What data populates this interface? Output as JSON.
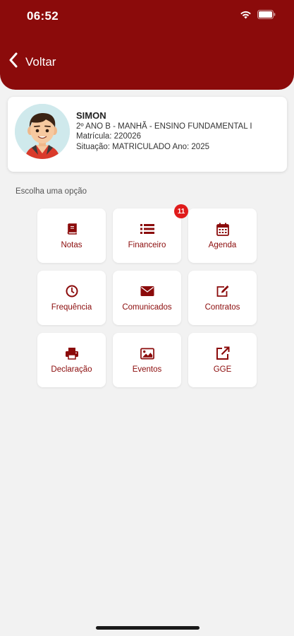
{
  "status_bar": {
    "time": "06:52"
  },
  "header": {
    "back_label": "Voltar"
  },
  "student": {
    "name": "SIMON",
    "class_line": "2º ANO B - MANHÃ - ENSINO FUNDAMENTAL I",
    "matricula_line": "Matrícula: 220026",
    "situacao_line": "Situação: MATRICULADO Ano: 2025"
  },
  "section_label": "Escolha uma opção",
  "menu": [
    {
      "label": "Notas",
      "icon": "book-icon"
    },
    {
      "label": "Financeiro",
      "icon": "list-icon",
      "badge": "11"
    },
    {
      "label": "Agenda",
      "icon": "calendar-icon"
    },
    {
      "label": "Frequência",
      "icon": "clock-icon"
    },
    {
      "label": "Comunicados",
      "icon": "envelope-icon"
    },
    {
      "label": "Contratos",
      "icon": "edit-icon"
    },
    {
      "label": "Declaração",
      "icon": "printer-icon"
    },
    {
      "label": "Eventos",
      "icon": "image-icon"
    },
    {
      "label": "GGE",
      "icon": "external-link-icon"
    }
  ],
  "colors": {
    "brand": "#8b0b0b",
    "badge": "#e01b1b",
    "background": "#f2f2f2"
  }
}
